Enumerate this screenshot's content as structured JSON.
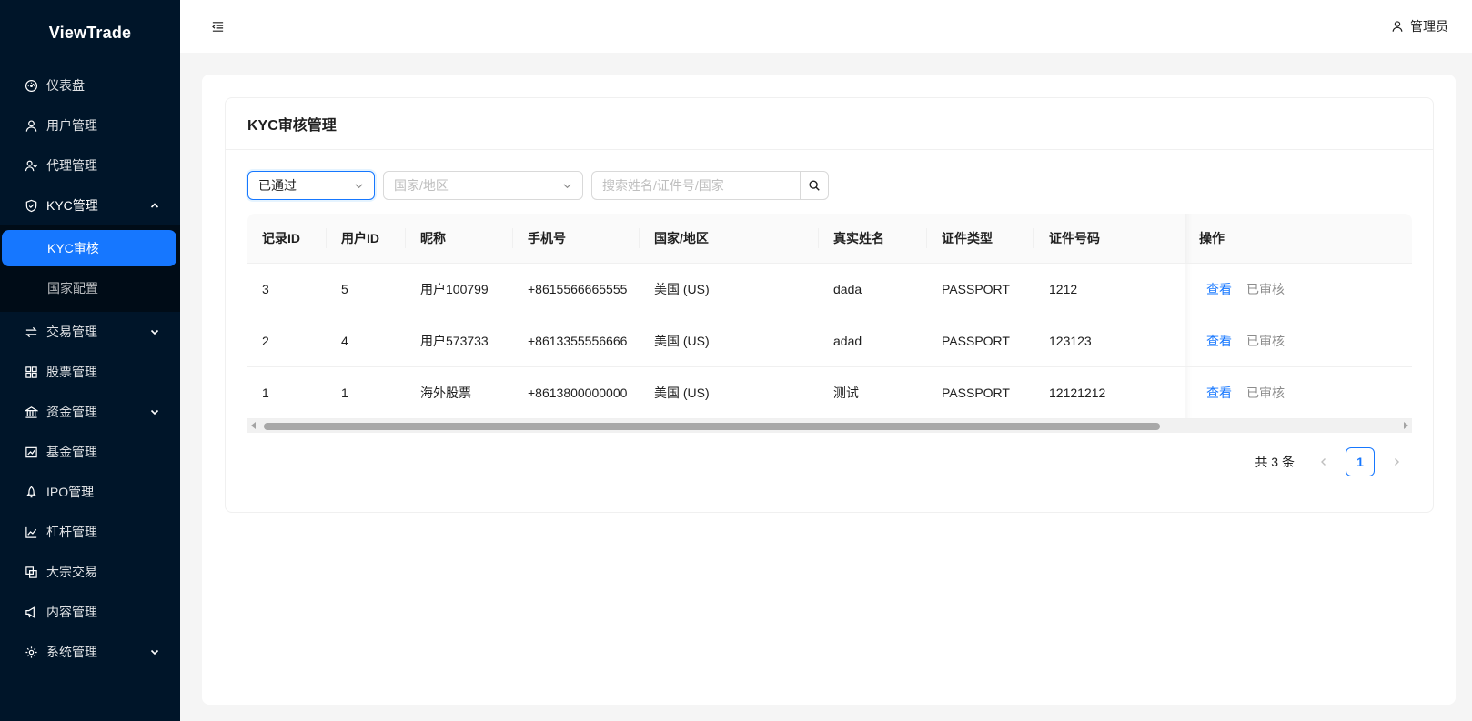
{
  "app": {
    "logo": "ViewTrade"
  },
  "sidebar": {
    "items": [
      {
        "label": "仪表盘",
        "icon": "dashboard-icon"
      },
      {
        "label": "用户管理",
        "icon": "user-icon"
      },
      {
        "label": "代理管理",
        "icon": "agent-icon"
      },
      {
        "label": "KYC管理",
        "icon": "shield-check-icon",
        "expanded": true
      },
      {
        "label": "交易管理",
        "icon": "swap-icon"
      },
      {
        "label": "股票管理",
        "icon": "grid-icon"
      },
      {
        "label": "资金管理",
        "icon": "bank-icon"
      },
      {
        "label": "基金管理",
        "icon": "fund-chart-icon"
      },
      {
        "label": "IPO管理",
        "icon": "rocket-icon"
      },
      {
        "label": "杠杆管理",
        "icon": "line-chart-icon"
      },
      {
        "label": "大宗交易",
        "icon": "block-icon"
      },
      {
        "label": "内容管理",
        "icon": "notification-icon"
      },
      {
        "label": "系统管理",
        "icon": "gear-icon"
      }
    ],
    "kyc_sub": [
      {
        "label": "KYC审核",
        "active": true
      },
      {
        "label": "国家配置",
        "active": false
      }
    ]
  },
  "header": {
    "user": "管理员"
  },
  "card": {
    "title": "KYC审核管理"
  },
  "filters": {
    "status_value": "已通过",
    "country_placeholder": "国家/地区",
    "search_placeholder": "搜索姓名/证件号/国家"
  },
  "table": {
    "columns": [
      "记录ID",
      "用户ID",
      "昵称",
      "手机号",
      "国家/地区",
      "真实姓名",
      "证件类型",
      "证件号码",
      "操作"
    ],
    "rows": [
      {
        "record_id": "3",
        "user_id": "5",
        "nickname": "用户100799",
        "phone": "+8615566665555",
        "country": "美国 (US)",
        "real_name": "dada",
        "id_type": "PASSPORT",
        "id_number": "1212",
        "view": "查看",
        "status": "已审核"
      },
      {
        "record_id": "2",
        "user_id": "4",
        "nickname": "用户573733",
        "phone": "+8613355556666",
        "country": "美国 (US)",
        "real_name": "adad",
        "id_type": "PASSPORT",
        "id_number": "123123",
        "view": "查看",
        "status": "已审核"
      },
      {
        "record_id": "1",
        "user_id": "1",
        "nickname": "海外股票",
        "phone": "+8613800000000",
        "country": "美国 (US)",
        "real_name": "测试",
        "id_type": "PASSPORT",
        "id_number": "12121212",
        "view": "查看",
        "status": "已审核"
      }
    ]
  },
  "pagination": {
    "total": "共 3 条",
    "current": "1"
  }
}
